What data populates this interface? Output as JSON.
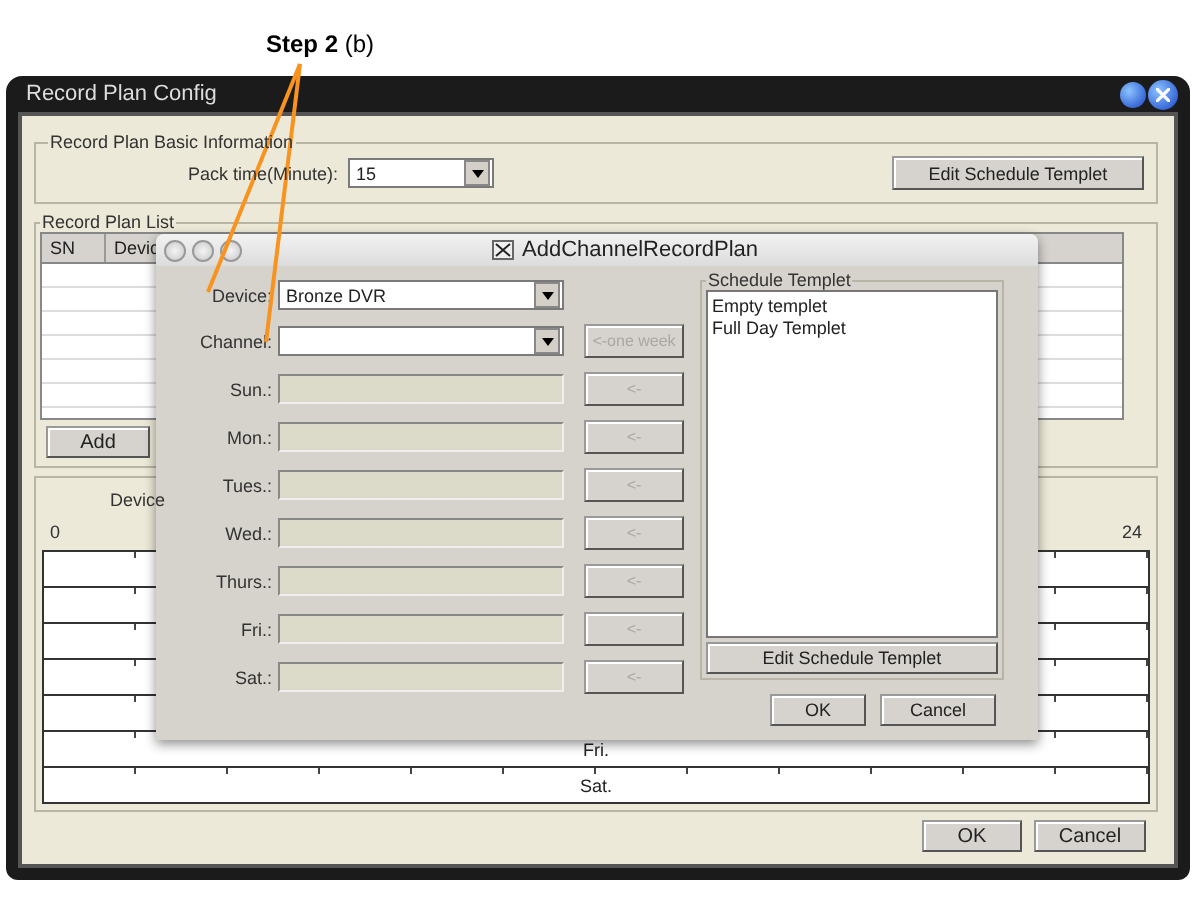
{
  "annotation": {
    "text": "**Step 2** (b)"
  },
  "window": {
    "title": "Record Plan Config"
  },
  "basic_info": {
    "title": "Record Plan Basic Information",
    "pack_time_label": "Pack time(Minute):",
    "pack_time_value": "15",
    "edit_button": "Edit Schedule Templet"
  },
  "plan_list": {
    "title": "Record Plan List",
    "columns": [
      "SN",
      "Devic"
    ],
    "add_button": "Add"
  },
  "timeline": {
    "title": "Device",
    "start": "0",
    "end": "24",
    "row_labels": [
      "Fri.",
      "Sat."
    ]
  },
  "buttons": [
    "OK",
    "Cancel"
  ],
  "dialog": {
    "title": "AddChannelRecordPlan",
    "device_label": "Device:",
    "device_value": "Bronze DVR",
    "channel_label": "Channel:",
    "one_week_button": {
      "label": "<-one week",
      "disabled": true
    },
    "days": [
      {
        "label": "Sun.:",
        "button": "<-",
        "disabled": true
      },
      {
        "label": "Mon.:",
        "button": "<-",
        "disabled": true
      },
      {
        "label": "Tues.:",
        "button": "<-",
        "disabled": true
      },
      {
        "label": "Wed.:",
        "button": "<-",
        "disabled": true
      },
      {
        "label": "Thurs.:",
        "button": "<-",
        "disabled": true
      },
      {
        "label": "Fri.:",
        "button": "<-",
        "disabled": true
      },
      {
        "label": "Sat.:",
        "button": "<-",
        "disabled": true
      }
    ],
    "templet_group": {
      "title": "Schedule Templet",
      "items": [
        {
          "label": "Empty templet",
          "selected": false
        },
        {
          "label": "Full Day Templet",
          "selected": false
        }
      ],
      "edit_button": "Edit Schedule Templet"
    },
    "buttons": [
      "OK",
      "Cancel"
    ]
  }
}
